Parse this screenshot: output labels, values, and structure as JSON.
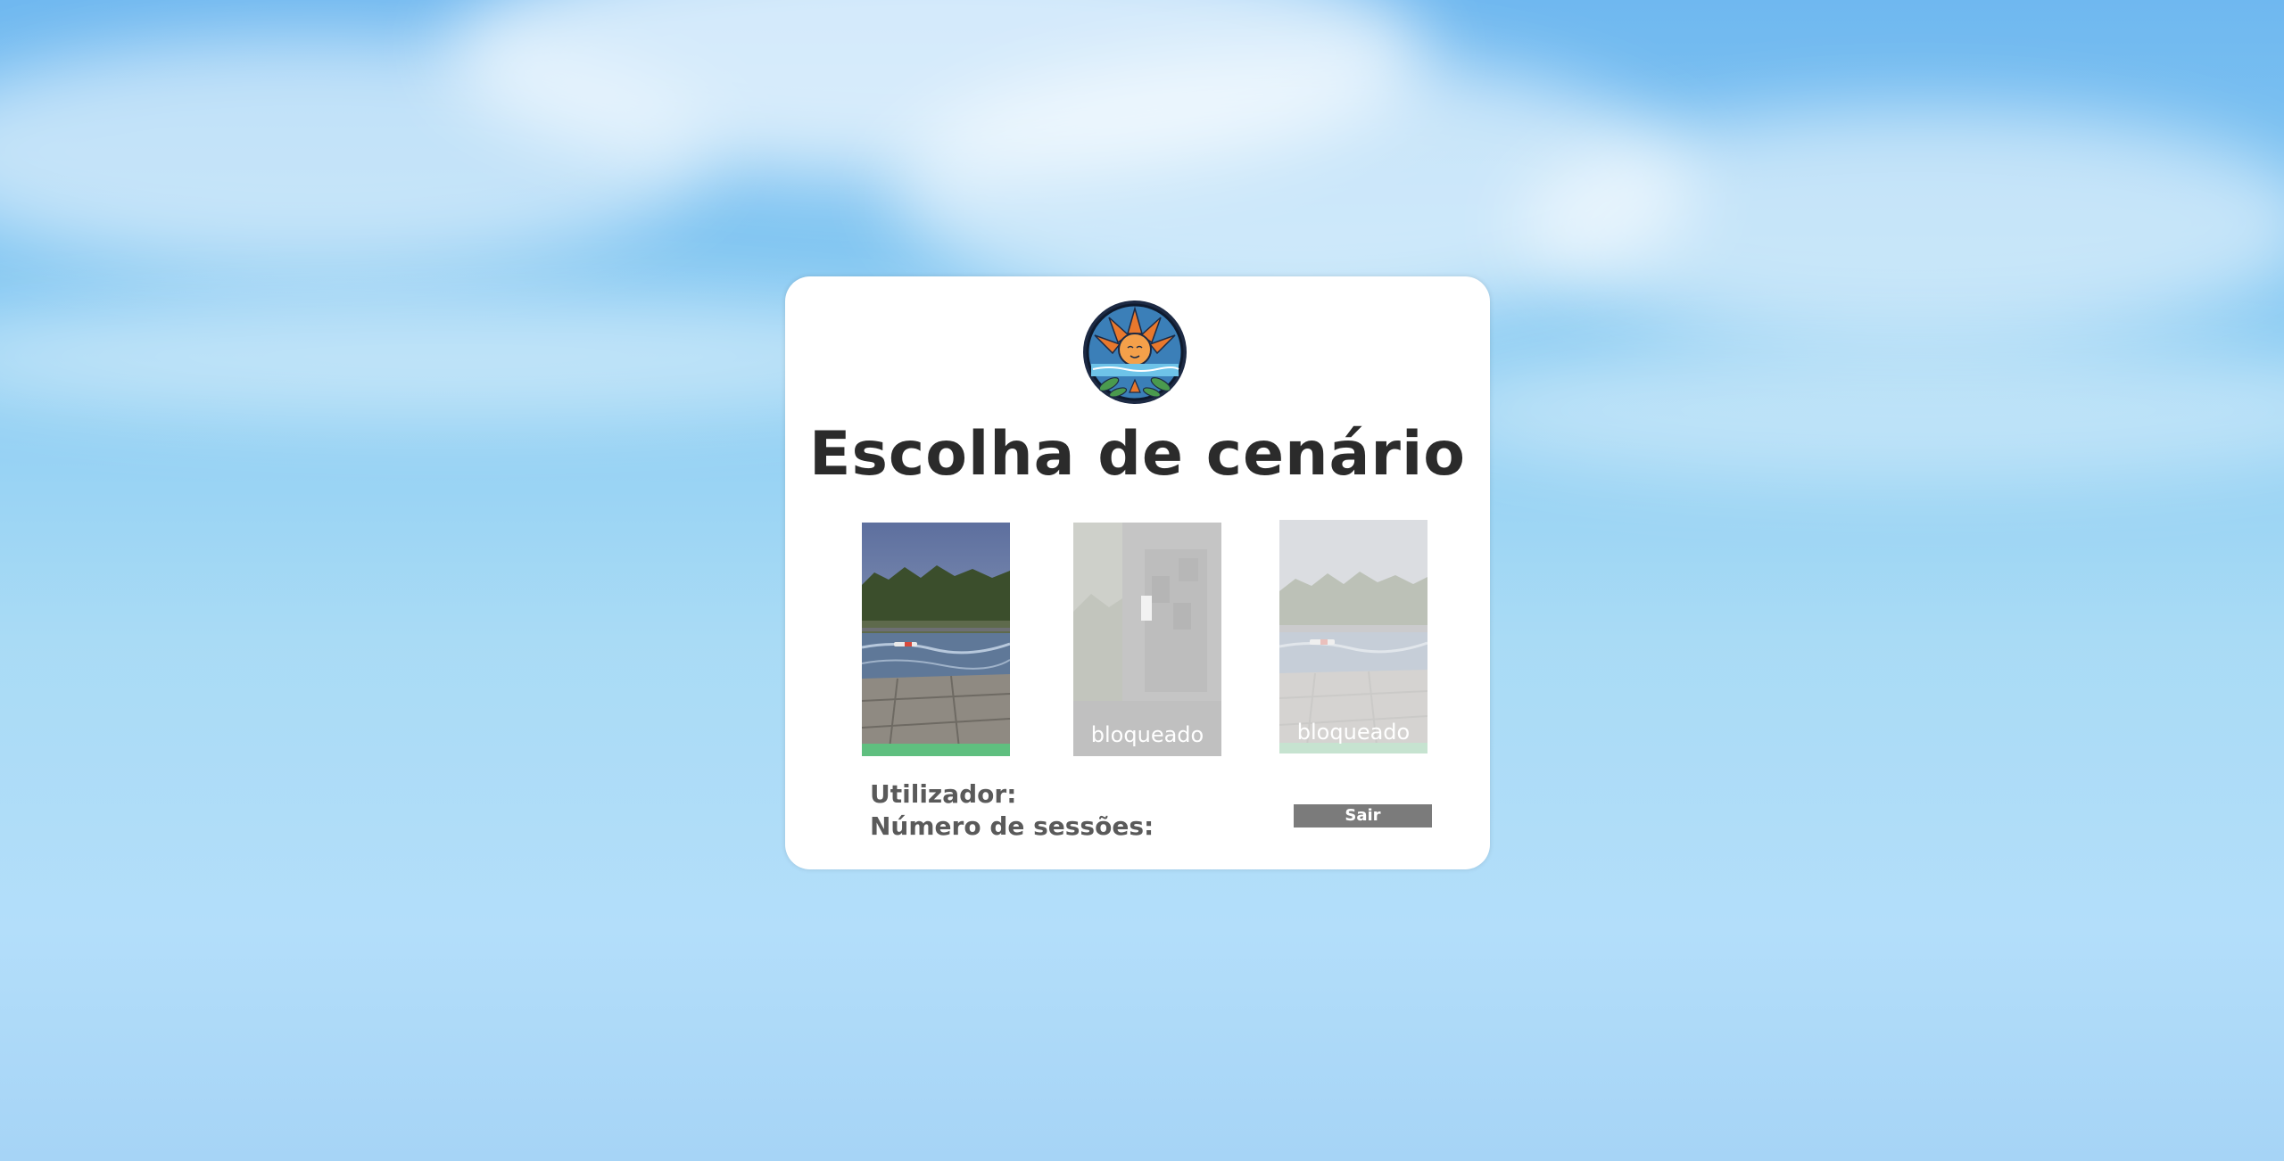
{
  "title": "Escolha de cenário",
  "scenes": [
    {
      "status": "available",
      "label": ""
    },
    {
      "status": "locked",
      "label": "bloqueado"
    },
    {
      "status": "locked",
      "label": "bloqueado"
    }
  ],
  "info": {
    "user_label": "Utilizador:",
    "sessions_label": "Número de sessões:"
  },
  "exit_label": "Sair",
  "colors": {
    "card_bg": "#ffffff",
    "title": "#2b2b2b",
    "info_text": "#5a5a5a",
    "exit_button": "#7b7b7b",
    "scene_floor_accent": "#5fbf7f"
  },
  "icons": {
    "logo": "sun-lotus-logo-icon"
  }
}
